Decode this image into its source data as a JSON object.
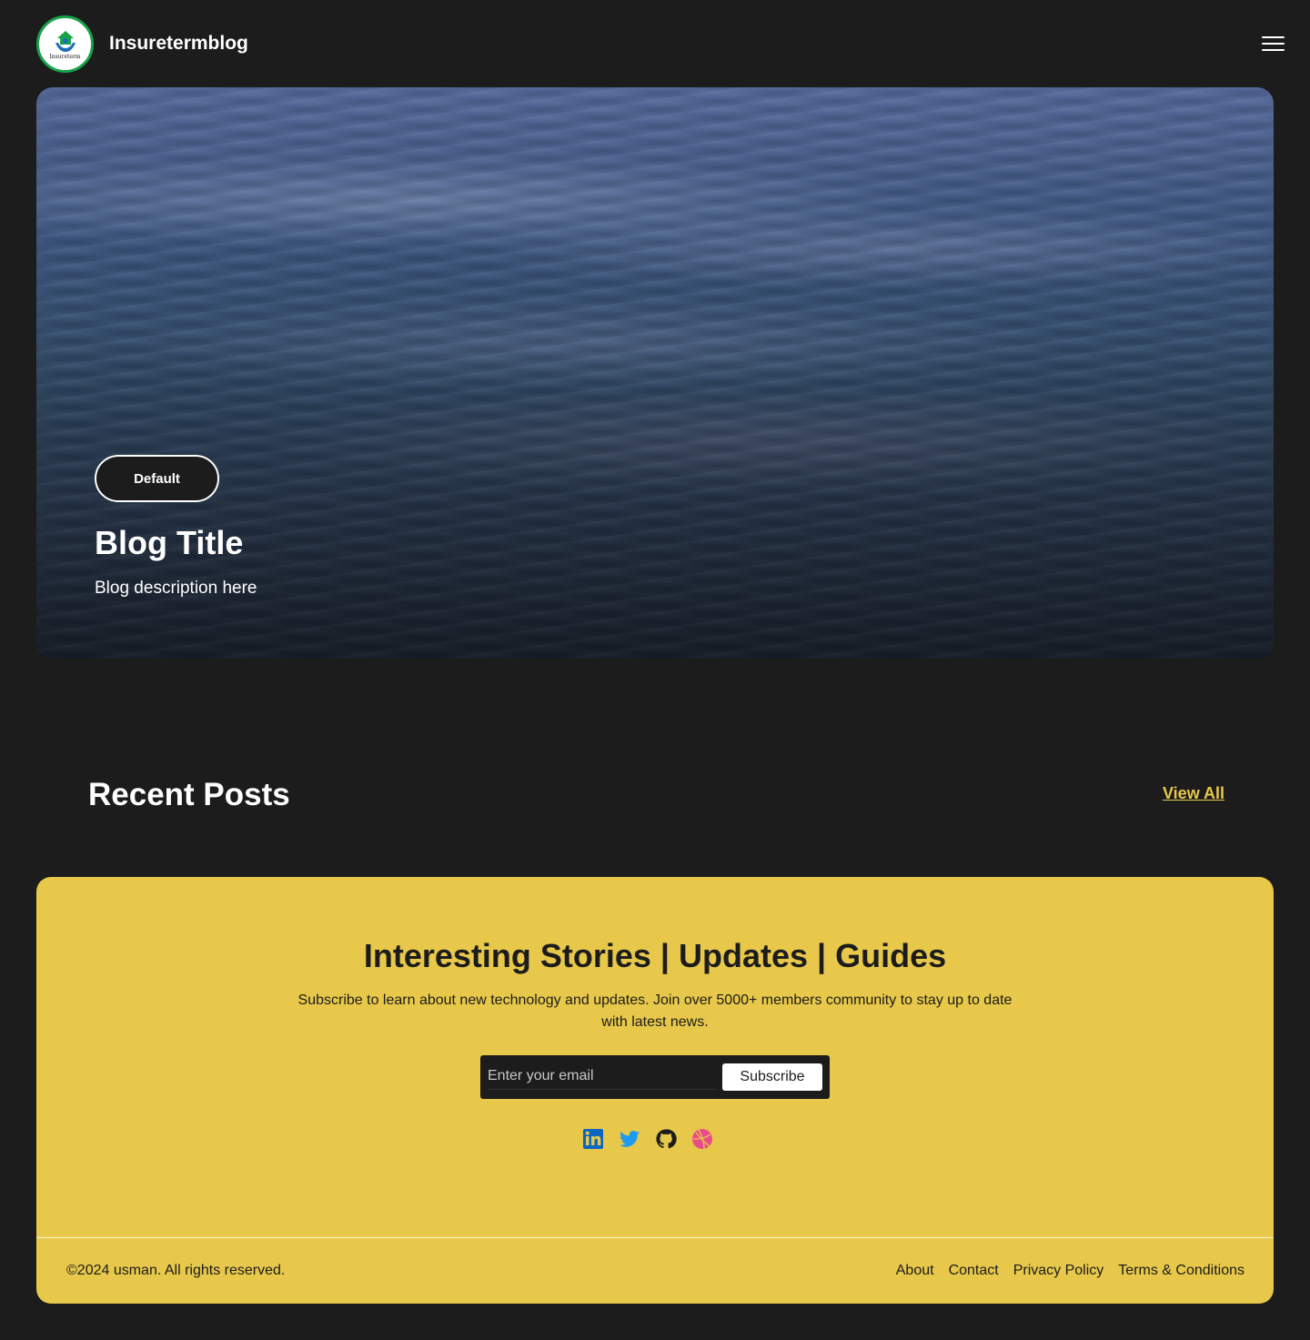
{
  "header": {
    "logo_text": "Insureterm",
    "brand": "Insuretermblog"
  },
  "hero": {
    "badge": "Default",
    "title": "Blog Title",
    "description": "Blog description here"
  },
  "recent": {
    "title": "Recent Posts",
    "view_all": "View All"
  },
  "newsletter": {
    "heading": "Interesting Stories | Updates | Guides",
    "subtitle": "Subscribe to learn about new technology and updates. Join over 5000+ members community to stay up to date with latest news.",
    "email_placeholder": "Enter your email",
    "subscribe_label": "Subscribe",
    "socials": [
      "linkedin-icon",
      "twitter-icon",
      "github-icon",
      "dribbble-icon"
    ]
  },
  "footer": {
    "copyright": "©2024 usman. All rights reserved.",
    "links": [
      "About",
      "Contact",
      "Privacy Policy",
      "Terms & Conditions"
    ]
  },
  "colors": {
    "background": "#1c1c1c",
    "accent": "#e8c84a",
    "logo_ring": "#16a34a"
  }
}
